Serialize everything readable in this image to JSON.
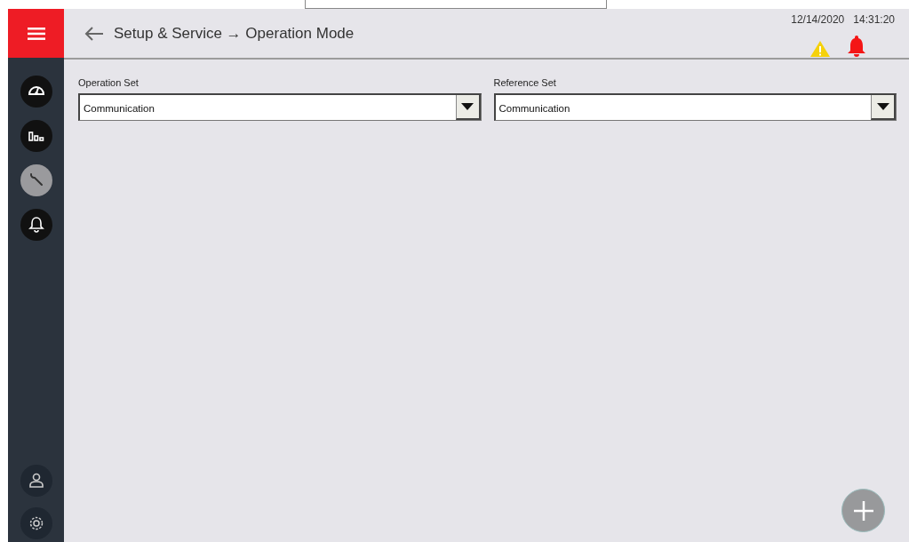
{
  "header": {
    "title": "Setup & Service → Operation Mode",
    "date": "12/14/2020",
    "time": "14:31:20"
  },
  "sidebar": {
    "items": [
      {
        "kind": "gauge",
        "selected": false
      },
      {
        "kind": "chart",
        "selected": false
      },
      {
        "kind": "wrench",
        "selected": true
      },
      {
        "kind": "bell",
        "selected": false
      }
    ],
    "bottom_items": [
      {
        "kind": "user"
      },
      {
        "kind": "gear"
      }
    ]
  },
  "fields": [
    {
      "label": "Operation Set",
      "value": "Communication"
    },
    {
      "label": "Reference Set",
      "value": "Communication"
    }
  ]
}
